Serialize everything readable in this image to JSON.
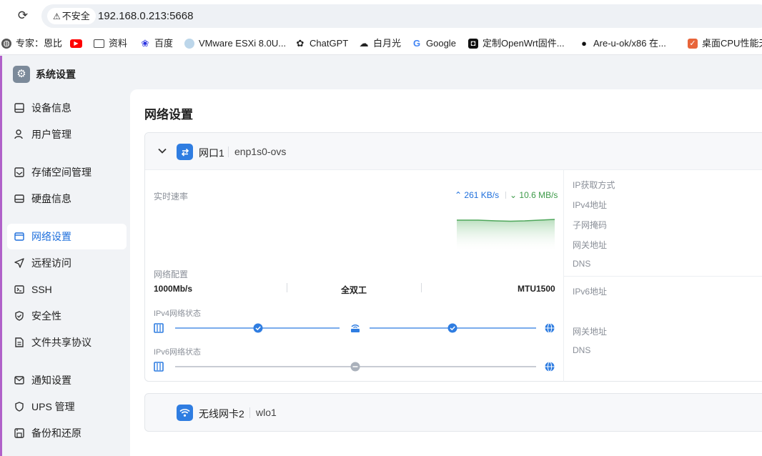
{
  "browser": {
    "security_label": "不安全",
    "url": "192.168.0.213:5668"
  },
  "bookmarks": [
    {
      "label": "专家：恩比",
      "icon": "globe-icon"
    },
    {
      "label": "",
      "icon": "youtube-icon"
    },
    {
      "label": "资料",
      "icon": "folder-icon"
    },
    {
      "label": "百度",
      "icon": "baidu-icon"
    },
    {
      "label": "VMware ESXi 8.0U...",
      "icon": "vmware-icon"
    },
    {
      "label": "ChatGPT",
      "icon": "chatgpt-icon"
    },
    {
      "label": "白月光",
      "icon": "cloud-icon"
    },
    {
      "label": "Google",
      "icon": "google-icon"
    },
    {
      "label": "定制OpenWrt固件...",
      "icon": "openwrt-icon"
    },
    {
      "label": "Are-u-ok/x86 在...",
      "icon": "github-icon"
    },
    {
      "label": "桌面CPU性能天",
      "icon": "cpu-site-icon"
    }
  ],
  "sidebar": {
    "app_title": "系统设置",
    "items": [
      {
        "label": "设备信息",
        "icon": "device-info-icon"
      },
      {
        "label": "用户管理",
        "icon": "user-icon"
      },
      {
        "label": "存储空间管理",
        "icon": "storage-icon"
      },
      {
        "label": "硬盘信息",
        "icon": "disk-icon"
      },
      {
        "label": "网络设置",
        "icon": "network-icon"
      },
      {
        "label": "远程访问",
        "icon": "send-icon"
      },
      {
        "label": "SSH",
        "icon": "terminal-icon"
      },
      {
        "label": "安全性",
        "icon": "shield-icon"
      },
      {
        "label": "文件共享协议",
        "icon": "file-icon"
      },
      {
        "label": "通知设置",
        "icon": "mail-icon"
      },
      {
        "label": "UPS 管理",
        "icon": "ups-shield-icon"
      },
      {
        "label": "备份和还原",
        "icon": "backup-icon"
      }
    ],
    "active": "网络设置"
  },
  "main": {
    "title": "网络设置",
    "port1": {
      "name": "网口1",
      "device": "enp1s0-ovs",
      "realtime_label": "实时速率",
      "upload": "261 KB/s",
      "download": "10.6 MB/s",
      "config_label": "网络配置",
      "speed": "1000Mb/s",
      "duplex": "全双工",
      "mtu": "MTU1500",
      "ipv4_status_label": "IPv4网络状态",
      "ipv6_status_label": "IPv6网络状态",
      "ipv4_status": [
        "ok",
        "ok"
      ],
      "ipv6_status": [
        "pending"
      ],
      "info": {
        "ip_method": "IP获取方式",
        "ipv4_addr": "IPv4地址",
        "subnet": "子网掩码",
        "gateway": "网关地址",
        "dns": "DNS",
        "ipv6_addr": "IPv6地址",
        "gateway6": "网关地址",
        "dns6": "DNS"
      }
    },
    "port2": {
      "name": "无线网卡2",
      "device": "wlo1"
    }
  },
  "colors": {
    "accent": "#1e6fdc",
    "download_green": "#3c9a48",
    "sidebar_border": "#b061c9"
  }
}
